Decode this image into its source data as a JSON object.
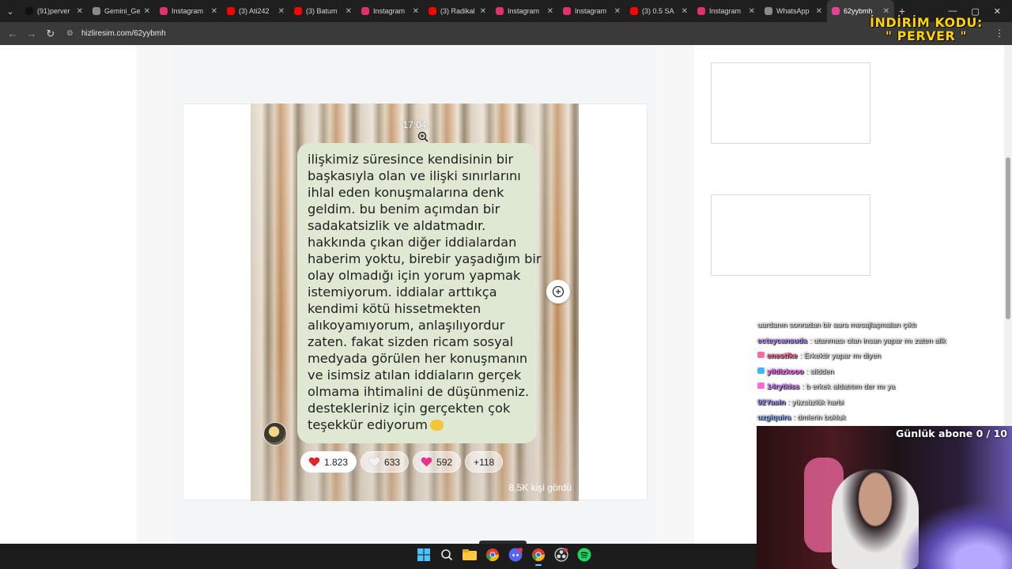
{
  "browser": {
    "tabs": [
      {
        "title": "(91)perver",
        "favicon": "tiktok-icon",
        "color": "#111111"
      },
      {
        "title": "Gemini_Ge",
        "favicon": "globe-icon",
        "color": "#8a8a8a"
      },
      {
        "title": "Instagram",
        "favicon": "instagram-icon",
        "color": "#e1306c"
      },
      {
        "title": "(3) Ati242",
        "favicon": "youtube-icon",
        "color": "#ff0000"
      },
      {
        "title": "(3) Batum",
        "favicon": "youtube-icon",
        "color": "#ff0000"
      },
      {
        "title": "Instagram",
        "favicon": "instagram-icon",
        "color": "#e1306c"
      },
      {
        "title": "(3) Radikal",
        "favicon": "youtube-icon",
        "color": "#ff0000"
      },
      {
        "title": "Instagram",
        "favicon": "instagram-icon",
        "color": "#e1306c"
      },
      {
        "title": "Instagram",
        "favicon": "instagram-icon",
        "color": "#e1306c"
      },
      {
        "title": "(3) 0.5 SA",
        "favicon": "youtube-icon",
        "color": "#ff0000"
      },
      {
        "title": "Instagram",
        "favicon": "instagram-icon",
        "color": "#e1306c"
      },
      {
        "title": "WhatsApp",
        "favicon": "globe-icon",
        "color": "#8a8a8a"
      },
      {
        "title": "62yybmh",
        "favicon": "image-host-icon",
        "color": "#e84393",
        "active": true
      }
    ],
    "url": "hizliresim.com/62yybmh"
  },
  "overlay": {
    "promo_line1": "İNDİRİM KODU:",
    "promo_line2": "\" PERVER \"",
    "cam_label": "Günlük abone 0 / 10"
  },
  "story": {
    "time": "17:04",
    "message_lines": [
      "ilişkimiz süresince kendisinin bir",
      "başkasıyla olan ve ilişki sınırlarını",
      "ihlal eden konuşmalarına denk",
      "geldim. bu benim açımdan bir",
      "sadakatsizlik ve aldatmadır.",
      "hakkında çıkan diğer iddialardan",
      "haberim yoktu, birebir yaşadığım bir",
      "olay olmadığı için yorum yapmak",
      "istemiyorum. iddialar arttıkça",
      "kendimi kötü hissetmekten",
      "alıkoyamıyorum, anlaşılıyordur",
      "zaten. fakat sizden ricam sosyal",
      "medyada görülen her konuşmanın",
      "ve isimsiz atılan iddiaların gerçek",
      "olmama ihtimalini de düşünmeniz.",
      "destekleriniz için gerçekten çok",
      "teşekkür ediyorum"
    ],
    "reactions": [
      {
        "count": "1.823",
        "icon": "red-heart-icon",
        "color": "#e0242c"
      },
      {
        "count": "633",
        "icon": "white-heart-icon",
        "color": "#f2f2f2"
      },
      {
        "count": "592",
        "icon": "pink-heart-icon",
        "color": "#e8338d"
      },
      {
        "count": "+118"
      }
    ],
    "seen": "8,5K kişi gördü"
  },
  "chat": [
    {
      "user": "",
      "text": "uardanın sonradan bir aura mesajlaşmaları çıktı",
      "color": "#dddddd",
      "badge": ""
    },
    {
      "user": "ecteycansuda",
      "text": ": utanması olan insan yapar mı zaten allk",
      "color": "#b48cff",
      "badge": ""
    },
    {
      "user": "enestfke",
      "text": ": Erkektir yapar mı diyen",
      "color": "#ff6b9a",
      "badge": "#ff6b9a"
    },
    {
      "user": "yildizkooo",
      "text": ": sildden",
      "color": "#ff66ff",
      "badge": "#3fb6ff"
    },
    {
      "user": "14rytkiss",
      "text": ": b erkek aldatıtım der mı ya",
      "color": "#c87bff",
      "badge": "#ff6bd6"
    },
    {
      "user": "92Yasin",
      "text": ": yüzsüzlük harbi",
      "color": "#9f8bff",
      "badge": ""
    },
    {
      "user": "uzgiquira",
      "text": ": dmlerin bokluk",
      "color": "#8fb0ff",
      "badge": ""
    }
  ]
}
